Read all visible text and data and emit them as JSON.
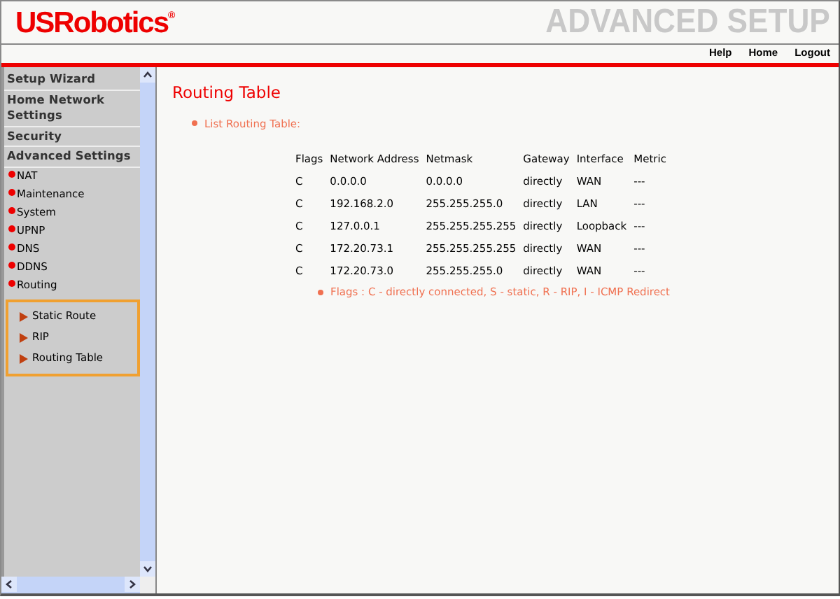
{
  "header": {
    "logo": "USRobotics",
    "logo_mark": "®",
    "title": "ADVANCED SETUP"
  },
  "top_links": [
    "Help",
    "Home",
    "Logout"
  ],
  "sidebar": {
    "sections": [
      {
        "label": "Setup Wizard",
        "kind": "header"
      },
      {
        "label": "Home Network Settings",
        "kind": "header"
      },
      {
        "label": "Security",
        "kind": "header"
      },
      {
        "label": "Advanced Settings",
        "kind": "header"
      },
      {
        "label": "NAT",
        "kind": "item"
      },
      {
        "label": "Maintenance",
        "kind": "item"
      },
      {
        "label": "System",
        "kind": "item"
      },
      {
        "label": "UPNP",
        "kind": "item"
      },
      {
        "label": "DNS",
        "kind": "item"
      },
      {
        "label": "DDNS",
        "kind": "item"
      },
      {
        "label": "Routing",
        "kind": "item",
        "children": [
          {
            "label": "Static Route"
          },
          {
            "label": "RIP"
          },
          {
            "label": "Routing Table"
          }
        ]
      }
    ]
  },
  "main": {
    "title": "Routing Table",
    "bullet": "List Routing Table:",
    "table": {
      "columns": [
        "Flags",
        "Network Address",
        "Netmask",
        "Gateway",
        "Interface",
        "Metric"
      ],
      "rows": [
        [
          "C",
          "0.0.0.0",
          "0.0.0.0",
          "directly",
          "WAN",
          "---"
        ],
        [
          "C",
          "192.168.2.0",
          "255.255.255.0",
          "directly",
          "LAN",
          "---"
        ],
        [
          "C",
          "127.0.0.1",
          "255.255.255.255",
          "directly",
          "Loopback",
          "---"
        ],
        [
          "C",
          "172.20.73.1",
          "255.255.255.255",
          "directly",
          "WAN",
          "---"
        ],
        [
          "C",
          "172.20.73.0",
          "255.255.255.0",
          "directly",
          "WAN",
          "---"
        ]
      ]
    },
    "note": "Flags :  C - directly connected, S - static, R - RIP, I - ICMP Redirect"
  }
}
